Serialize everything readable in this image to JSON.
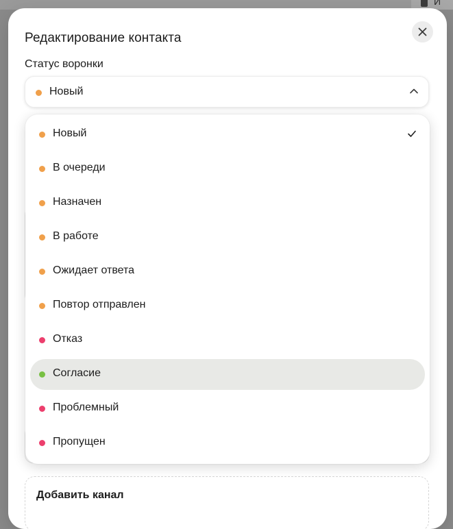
{
  "background": {
    "corner_text": "И"
  },
  "modal": {
    "title": "Редактирование контакта",
    "close_icon": "close-icon"
  },
  "funnel_status": {
    "label": "Статус воронки",
    "selected": "Новый",
    "selected_color": "#f0a04b",
    "chevron_icon": "chevron-up-icon"
  },
  "dropdown": {
    "options": [
      {
        "label": "Новый",
        "color": "#f0a04b",
        "selected": true
      },
      {
        "label": "В очереди",
        "color": "#f0a04b"
      },
      {
        "label": "Назначен",
        "color": "#f0a04b"
      },
      {
        "label": "В работе",
        "color": "#f0a04b"
      },
      {
        "label": "Ожидает ответа",
        "color": "#f0a04b"
      },
      {
        "label": "Повтор отправлен",
        "color": "#f0a04b"
      },
      {
        "label": "Отказ",
        "color": "#ec3f6d"
      },
      {
        "label": "Согласие",
        "color": "#78c043",
        "highlighted": true
      },
      {
        "label": "Проблемный",
        "color": "#ec3f6d"
      },
      {
        "label": "Пропущен",
        "color": "#ec3f6d"
      }
    ],
    "check_icon": "check-icon"
  },
  "add_channel": {
    "title": "Добавить канал"
  }
}
